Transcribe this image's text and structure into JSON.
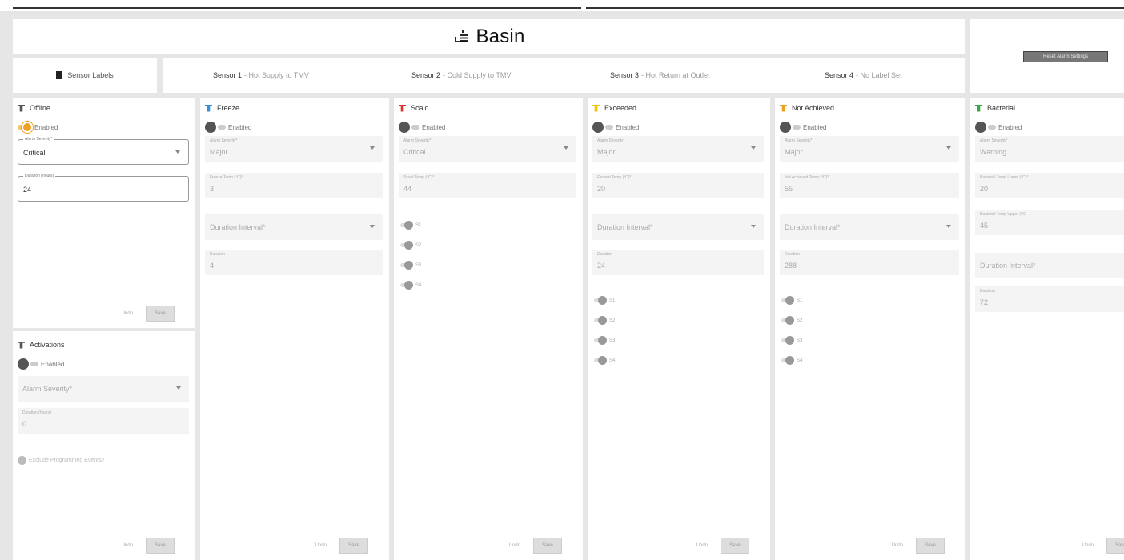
{
  "app": {
    "title": "Basin",
    "icon": "basin-icon"
  },
  "top_actions": {
    "reset_label": "Reset Alarm Settings"
  },
  "sensor_labels_button": {
    "label": "Sensor Labels",
    "icon": "document-icon"
  },
  "sensors": [
    {
      "name": "Sensor 1",
      "desc": " - Hot Supply to TMV"
    },
    {
      "name": "Sensor 2",
      "desc": " - Cold Supply to TMV"
    },
    {
      "name": "Sensor 3",
      "desc": " - Hot Return at Outlet"
    },
    {
      "name": "Sensor 4",
      "desc": " - No Label Set"
    }
  ],
  "colors": {
    "offline": "#555555",
    "freeze": "#3a8fd8",
    "scald": "#e0302a",
    "exceeded": "#f5c400",
    "not_achieved": "#f0a020",
    "bacterial": "#36a84a",
    "accent": "#f0a020"
  },
  "common": {
    "enabled": "Enabled",
    "undo": "Undo",
    "save": "Save",
    "s1": "S1",
    "s2": "S2",
    "s3": "S3",
    "s4": "S4"
  },
  "offline": {
    "title": "Offline",
    "enabled": true,
    "severity_label": "Alarm Severity*",
    "severity_value": "Critical",
    "duration_label": "Duration (hours)",
    "duration_value": "24"
  },
  "activations": {
    "title": "Activations",
    "severity_label": "Alarm Severity*",
    "duration_label": "Duration (hours)",
    "duration_value": "0",
    "exclude_label": "Exclude Programmed Events?"
  },
  "freeze": {
    "title": "Freeze",
    "severity_label": "Alarm Severity*",
    "severity_value": "Major",
    "temp_label": "Freeze Temp (°C)*",
    "temp_value": "3",
    "interval_label": "Duration Interval*",
    "duration_label": "Duration",
    "duration_value": "4"
  },
  "scald": {
    "title": "Scald",
    "severity_label": "Alarm Severity*",
    "severity_value": "Critical",
    "temp_label": "Scald Temp (°C)*",
    "temp_value": "44"
  },
  "exceeded": {
    "title": "Exceeded",
    "severity_label": "Alarm Severity*",
    "severity_value": "Major",
    "temp_label": "Exceed Temp (°C)*",
    "temp_value": "20",
    "interval_label": "Duration Interval*",
    "duration_label": "Duration",
    "duration_value": "24"
  },
  "not_achieved": {
    "title": "Not Achieved",
    "severity_label": "Alarm Severity*",
    "severity_value": "Major",
    "temp_label": "Not Achieved Temp (°C)*",
    "temp_value": "55",
    "interval_label": "Duration Interval*",
    "duration_label": "Duration",
    "duration_value": "288"
  },
  "bacterial": {
    "title": "Bacterial",
    "severity_label": "Alarm Severity*",
    "severity_value": "Warning",
    "temp_lower_label": "Bacterial Temp Lower (°C)*",
    "temp_lower_value": "20",
    "temp_upper_label": "Bacterial Temp Upper (°C)",
    "temp_upper_value": "45",
    "interval_label": "Duration Interval*",
    "duration_label": "Duration",
    "duration_value": "72"
  }
}
